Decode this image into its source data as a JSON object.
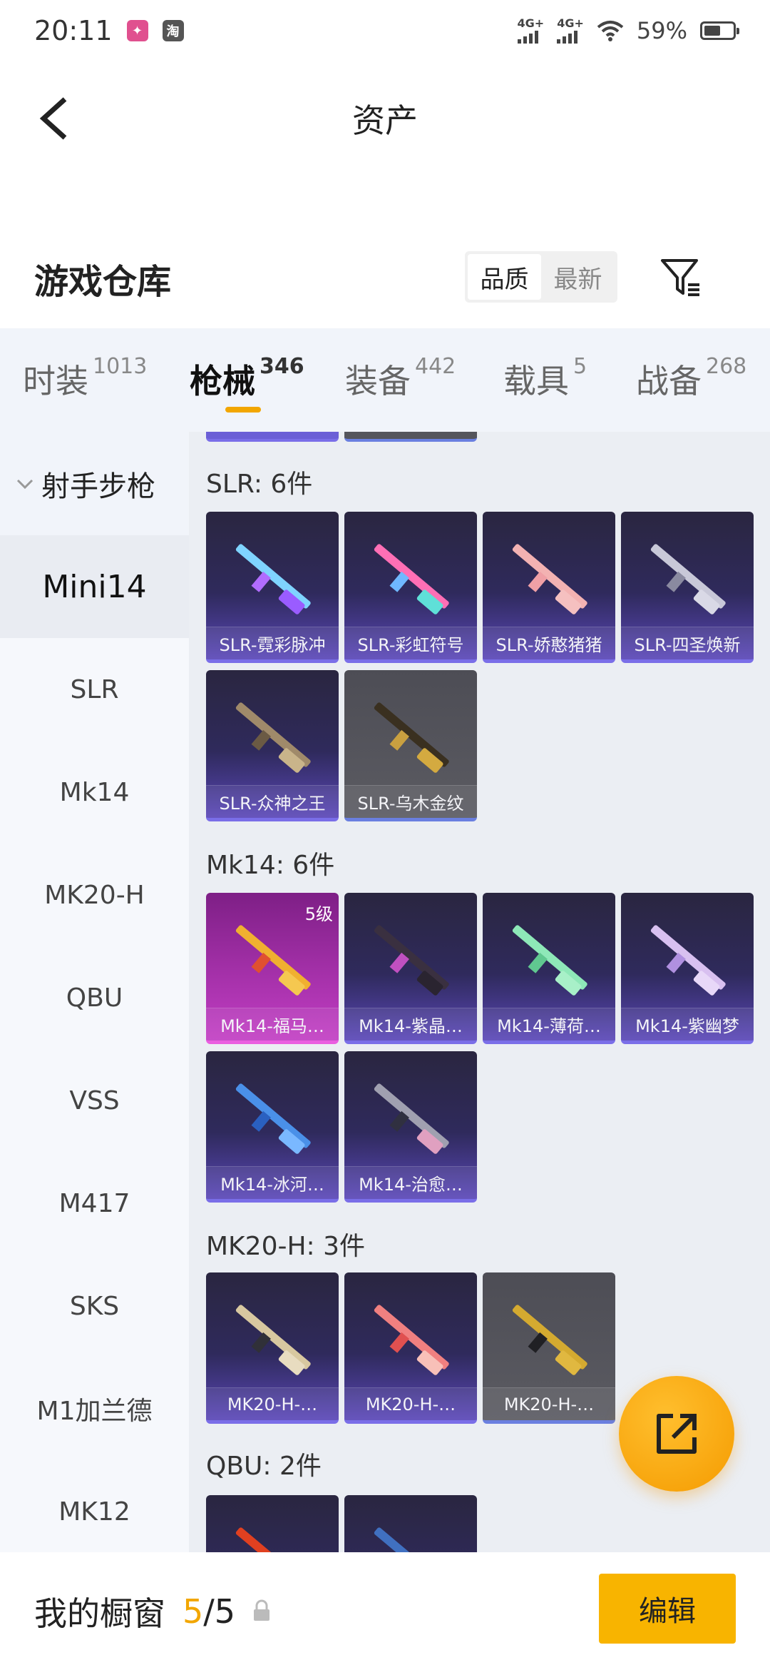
{
  "status_bar": {
    "time": "20:11",
    "app_icon_1": "app",
    "app_icon_2": "淘",
    "signal_1": "4G+",
    "signal_2": "4G+",
    "battery_text": "59%",
    "battery_level": 0.59
  },
  "header": {
    "title": "资产",
    "back_icon": "back-chevron-icon"
  },
  "warehouse": {
    "title": "游戏仓库",
    "sort_options": [
      "品质",
      "最新"
    ],
    "sort_active": 0,
    "filter_icon": "filter-icon"
  },
  "tabs": [
    {
      "label": "时装",
      "count": "1013"
    },
    {
      "label": "枪械",
      "count": "346"
    },
    {
      "label": "装备",
      "count": "442"
    },
    {
      "label": "载具",
      "count": "5"
    },
    {
      "label": "战备",
      "count": "268"
    }
  ],
  "active_tab": 1,
  "sidebar": {
    "group_label": "射手步枪",
    "items": [
      "Mini14",
      "SLR",
      "Mk14",
      "MK20-H",
      "QBU",
      "VSS",
      "M417",
      "SKS",
      "M1加兰德",
      "MK12"
    ],
    "active_item": 0
  },
  "sections": [
    {
      "label": "SLR: 6件",
      "items": [
        {
          "name": "SLR-霓彩脉冲"
        },
        {
          "name": "SLR-彩虹符号"
        },
        {
          "name": "SLR-娇憨猪猪"
        },
        {
          "name": "SLR-四圣焕新"
        },
        {
          "name": "SLR-众神之王"
        },
        {
          "name": "SLR-乌木金纹"
        }
      ]
    },
    {
      "label": "Mk14: 6件",
      "items": [
        {
          "name": "Mk14-福马…",
          "level": "5级"
        },
        {
          "name": "Mk14-紫晶…"
        },
        {
          "name": "Mk14-薄荷…"
        },
        {
          "name": "Mk14-紫幽梦"
        },
        {
          "name": "Mk14-冰河…"
        },
        {
          "name": "Mk14-治愈…"
        }
      ]
    },
    {
      "label": "MK20-H: 3件",
      "items": [
        {
          "name": "MK20-H-…"
        },
        {
          "name": "MK20-H-…"
        },
        {
          "name": "MK20-H-…"
        }
      ]
    },
    {
      "label": "QBU: 2件",
      "items": []
    }
  ],
  "fab_icon": "share-external-icon",
  "bottom_bar": {
    "label": "我的橱窗",
    "count_current": "5",
    "count_sep": "/",
    "count_total": "5",
    "lock_icon": "lock-icon",
    "edit_label": "编辑"
  },
  "colors": {
    "accent": "#f8b400",
    "tab_indicator": "#f2a600",
    "card_purple": "#2f2a5c",
    "card_gray": "#55555c",
    "card_pink": "#a12fa6"
  }
}
